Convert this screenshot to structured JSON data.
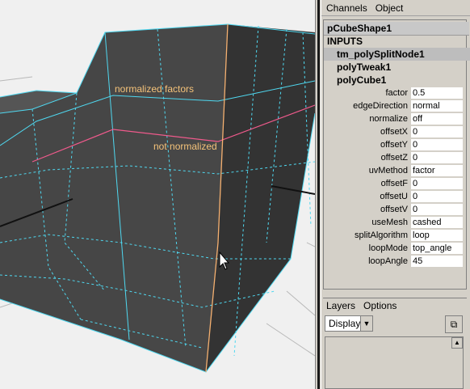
{
  "viewport": {
    "label_normalized": "normalized factors",
    "label_not_normalized": "not normalized"
  },
  "channel_box": {
    "menu": [
      "Channels",
      "Object"
    ],
    "shape_name": "pCubeShape1",
    "inputs_heading": "INPUTS",
    "inputs": [
      {
        "label": "tm_polySplitNode1",
        "selected": true
      },
      {
        "label": "polyTweak1",
        "selected": false
      },
      {
        "label": "polyCube1",
        "selected": false
      }
    ],
    "attributes": [
      {
        "name": "factor",
        "value": "0.5"
      },
      {
        "name": "edgeDirection",
        "value": "normal"
      },
      {
        "name": "normalize",
        "value": "off"
      },
      {
        "name": "offsetX",
        "value": "0"
      },
      {
        "name": "offsetY",
        "value": "0"
      },
      {
        "name": "offsetZ",
        "value": "0"
      },
      {
        "name": "uvMethod",
        "value": "factor"
      },
      {
        "name": "offsetF",
        "value": "0"
      },
      {
        "name": "offsetU",
        "value": "0"
      },
      {
        "name": "offsetV",
        "value": "0"
      },
      {
        "name": "useMesh",
        "value": "cashed"
      },
      {
        "name": "splitAlgorithm",
        "value": "loop"
      },
      {
        "name": "loopMode",
        "value": "top_angle"
      },
      {
        "name": "loopAngle",
        "value": "45"
      }
    ]
  },
  "layers": {
    "menu": [
      "Layers",
      "Options"
    ],
    "display_value": "Display",
    "new_layer_icon": "new-layer-icon",
    "scroll_icon": "scroll-up-icon"
  },
  "colors": {
    "mesh_face": "#454545",
    "mesh_face_dark": "#333333",
    "edge_cyan": "#4fd8f0",
    "edge_pink": "#f05a8c",
    "edge_orange": "#f5b070",
    "label": "#f5c37a"
  }
}
